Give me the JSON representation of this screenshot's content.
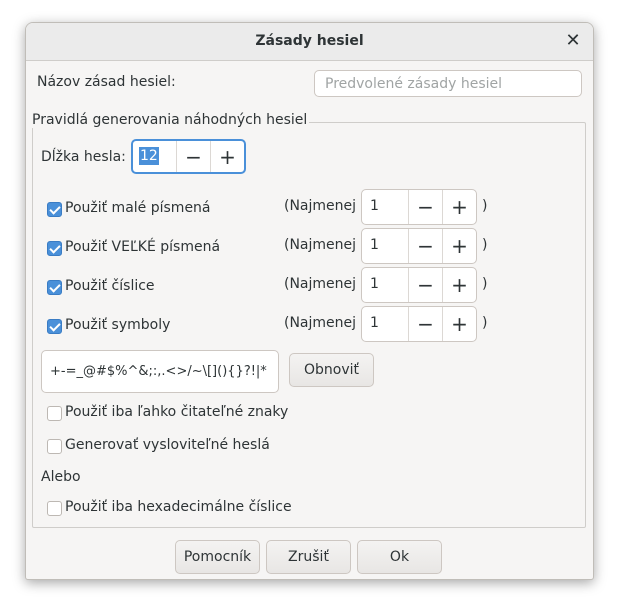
{
  "dialog": {
    "title": "Zásady hesiel"
  },
  "policy": {
    "label": "Názov zásad hesiel:",
    "placeholder": "Predvolené zásady hesiel",
    "value": ""
  },
  "rules": {
    "group_label": "Pravidlá generovania náhodných hesiel",
    "length_label": "Dĺžka hesla:",
    "length_value": "12",
    "options": [
      {
        "label": "Použiť malé písmená",
        "checked": true,
        "min_label": "(Najmenej",
        "min_value": "1",
        "close": ")"
      },
      {
        "label": "Použiť VEĽKÉ písmená",
        "checked": true,
        "min_label": "(Najmenej",
        "min_value": "1",
        "close": ")"
      },
      {
        "label": "Použiť číslice",
        "checked": true,
        "min_label": "(Najmenej",
        "min_value": "1",
        "close": ")"
      },
      {
        "label": "Použiť symboly",
        "checked": true,
        "min_label": "(Najmenej",
        "min_value": "1",
        "close": ")"
      }
    ],
    "symbols_value": "+-=_@#$%^&;:,.<>/~\\[](){}?!|*",
    "refresh_label": "Obnoviť",
    "readable_label": "Použiť iba ľahko čitateľné znaky",
    "pronounceable_label": "Generovať vysloviteľné heslá",
    "or_label": "Alebo",
    "hex_label": "Použiť iba hexadecimálne číslice"
  },
  "footer": {
    "help": "Pomocník",
    "cancel": "Zrušiť",
    "ok": "Ok"
  },
  "icons": {
    "minus": "minus-icon",
    "plus": "plus-icon",
    "close": "close-icon",
    "check": "checkmark-icon"
  },
  "colors": {
    "accent": "#4a90d9",
    "background": "#f6f5f4"
  }
}
